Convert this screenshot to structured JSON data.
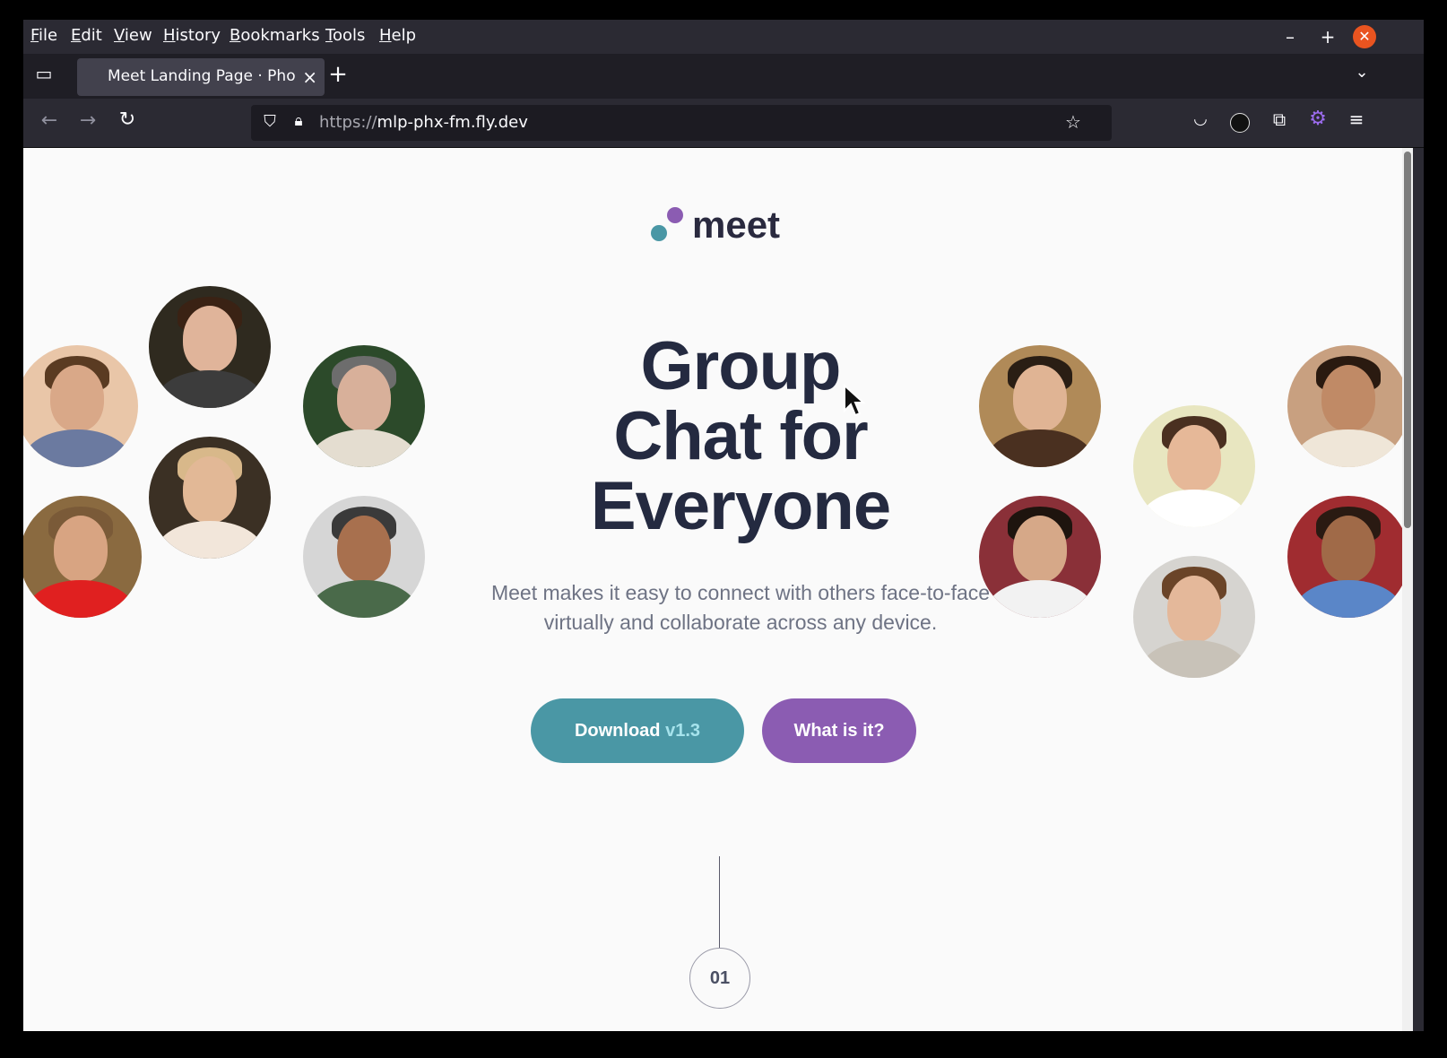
{
  "browser": {
    "menu": [
      "File",
      "Edit",
      "View",
      "History",
      "Bookmarks",
      "Tools",
      "Help"
    ],
    "tab_title": "Meet Landing Page · Phoenix Framework",
    "url_scheme": "https://",
    "url_host": "mlp-phx-fm.fly.dev",
    "icons": [
      "tab-overview-icon",
      "new-tab-icon",
      "list-tabs-icon",
      "back-icon",
      "forward-icon",
      "reload-icon",
      "shield-icon",
      "lock-icon",
      "star-icon",
      "pocket-icon",
      "account-icon",
      "extensions-icon",
      "addon-icon",
      "menu-icon"
    ]
  },
  "page": {
    "logo_text": "meet",
    "headline": [
      "Group",
      "Chat for",
      "Everyone"
    ],
    "subtext": "Meet makes it easy to connect with others face-to-face virtually and collaborate across any device.",
    "download_label": "Download",
    "download_version": "v1.3",
    "what_label": "What is it?",
    "step_number": "01"
  },
  "colors": {
    "teal": "#4a97a5",
    "purple": "#8b5cb2",
    "heading": "#242a40",
    "body_text": "#6e7384"
  }
}
